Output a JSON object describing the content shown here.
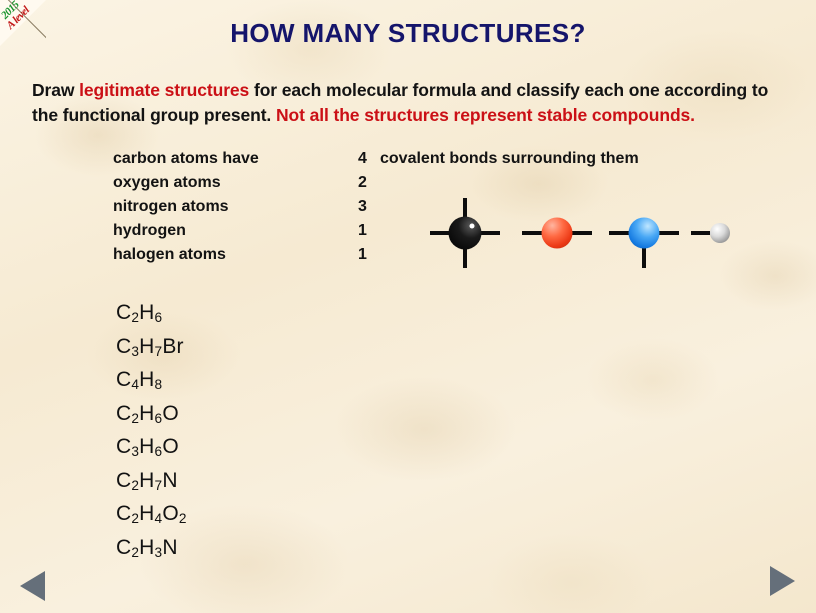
{
  "badge": {
    "year": "2015",
    "level": "A level"
  },
  "title": "HOW MANY STRUCTURES?",
  "instructions": {
    "seg1": "Draw ",
    "seg2_red": "legitimate structures",
    "seg3": " for each molecular formula and classify each one according to the functional group present.  ",
    "seg4_red": "Not all the structures represent stable compounds."
  },
  "valence": {
    "tail": "covalent bonds surrounding them",
    "rows": [
      {
        "name": "carbon atoms have",
        "count": "4"
      },
      {
        "name": "oxygen atoms",
        "count": "2"
      },
      {
        "name": "nitrogen atoms",
        "count": "3"
      },
      {
        "name": "hydrogen",
        "count": "1"
      },
      {
        "name": "halogen atoms",
        "count": "1"
      }
    ]
  },
  "atoms": [
    {
      "element": "carbon",
      "color": "#000000",
      "bonds": 4,
      "directions": [
        "up",
        "down",
        "left",
        "right"
      ]
    },
    {
      "element": "oxygen",
      "color": "#ec3a16",
      "bonds": 2,
      "directions": [
        "left",
        "right"
      ]
    },
    {
      "element": "nitrogen",
      "color": "#1479e0",
      "bonds": 3,
      "directions": [
        "left",
        "right",
        "down"
      ]
    },
    {
      "element": "hydrogen",
      "color": "#9b9b9b",
      "bonds": 1,
      "directions": [
        "left"
      ]
    }
  ],
  "formulas": [
    {
      "html": "C<sub>2</sub>H<sub>6</sub>",
      "plain": "C2H6"
    },
    {
      "html": "C<sub>3</sub>H<sub>7</sub>Br",
      "plain": "C3H7Br"
    },
    {
      "html": "C<sub>4</sub>H<sub>8</sub>",
      "plain": "C4H8"
    },
    {
      "html": "C<sub>2</sub>H<sub>6</sub>O",
      "plain": "C2H6O"
    },
    {
      "html": "C<sub>3</sub>H<sub>6</sub>O",
      "plain": "C3H6O"
    },
    {
      "html": "C<sub>2</sub>H<sub>7</sub>N",
      "plain": "C2H7N"
    },
    {
      "html": "C<sub>2</sub>H<sub>4</sub>O<sub>2</sub>",
      "plain": "C2H4O2"
    },
    {
      "html": "C<sub>2</sub>H<sub>3</sub>N",
      "plain": "C2H3N"
    }
  ],
  "nav": {
    "prev_label": "previous-slide",
    "next_label": "next-slide",
    "arrow_color": "#656f7a"
  },
  "colors": {
    "title": "#15156b",
    "accent_red": "#cb1016",
    "text": "#131313",
    "background": "#f8eed9"
  }
}
